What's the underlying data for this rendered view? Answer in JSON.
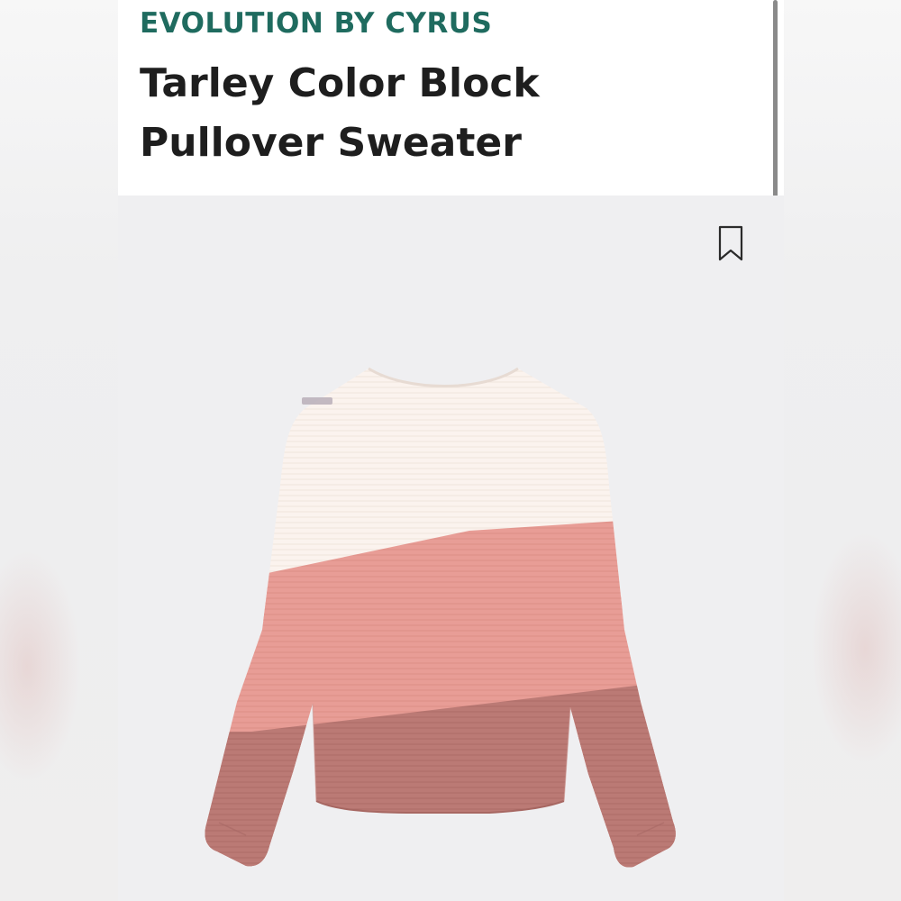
{
  "product": {
    "brand": "EVOLUTION BY CYRUS",
    "title_line1": "Tarley Color Block",
    "title_line2": "Pullover Sweater"
  },
  "icons": {
    "bookmark": "bookmark-icon"
  },
  "colors": {
    "brand": "#1f6b5f",
    "title": "#1e1e1e",
    "sweater_top": "#fbf3ee",
    "sweater_middle": "#e79a93",
    "sweater_bottom": "#ba7874"
  }
}
